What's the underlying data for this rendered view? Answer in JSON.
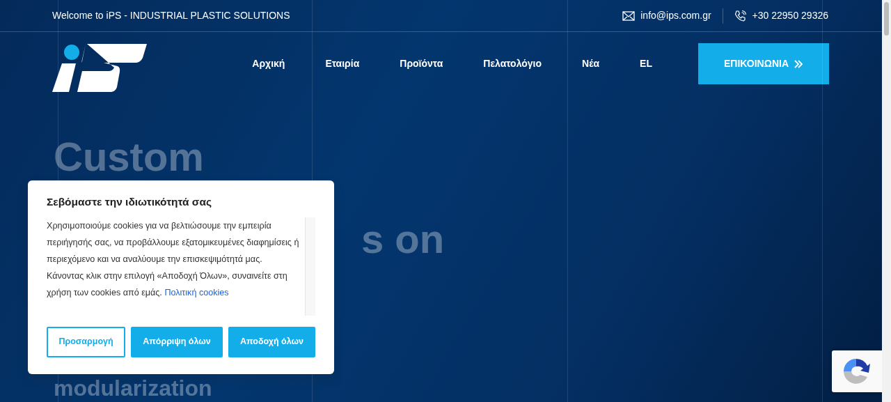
{
  "topbar": {
    "welcome": "Welcome to iPS - INDUSTRIAL PLASTIC SOLUTIONS",
    "email": "info@ips.com.gr",
    "phone": "+30 22950 29326"
  },
  "nav": {
    "items": [
      {
        "label": "Αρχική"
      },
      {
        "label": "Εταιρία"
      },
      {
        "label": "Προϊόντα"
      },
      {
        "label": "Πελατολόγιο"
      },
      {
        "label": "Νέα"
      },
      {
        "label": "EL"
      }
    ],
    "cta": "ΕΠΙΚΟΙΝΩΝΙΑ"
  },
  "hero": {
    "lines": [
      "Custom",
      "s on",
      "modularization"
    ]
  },
  "cookie_dialog": {
    "title": "Σεβόμαστε την ιδιωτικότητά σας",
    "text": "Χρησιμοποιούμε cookies για να βελτιώσουμε την εμπειρία περιήγησής σας, να προβάλλουμε εξατομικευμένες διαφημίσεις ή περιεχόμενο και να αναλύουμε την επισκεψιμότητά μας. Κάνοντας κλικ στην επιλογή «Αποδοχή Όλων», συναινείτε στη χρήση των cookies από εμάς.",
    "link": "Πολιτική cookies",
    "buttons": [
      {
        "label": "Προσαρμογή",
        "kind": "outline"
      },
      {
        "label": "Απόρριψη όλων",
        "kind": "filled"
      },
      {
        "label": "Αποδοχή όλων",
        "kind": "filled"
      }
    ]
  }
}
